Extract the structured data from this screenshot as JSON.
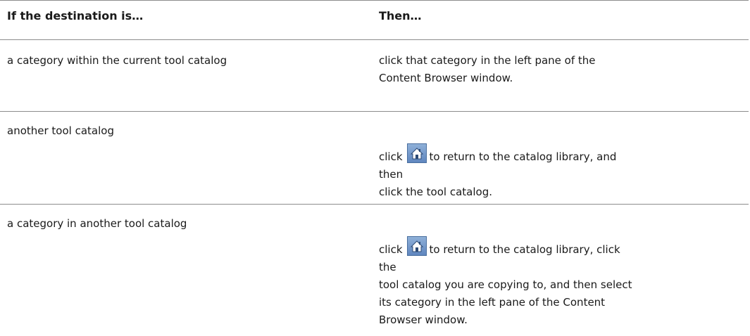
{
  "table": {
    "headers": {
      "col1": "If the destination is…",
      "col2": "Then…"
    },
    "rows": [
      {
        "destination": "a category within the current tool catalog",
        "action": "click that category in the left pane of the Content Browser window."
      },
      {
        "destination": "another tool catalog",
        "action_prefix": "click",
        "action_rest_1": "to return to the catalog library, and then",
        "action_rest_2": "click the tool catalog."
      },
      {
        "destination": "a category in another tool catalog",
        "action_prefix": "click",
        "action_rest_1": "to return to the catalog library, click the",
        "action_rest_2": "tool catalog you are copying to, and then select its category in the left pane of the Content Browser window."
      }
    ]
  },
  "icons": {
    "home": "home-icon"
  }
}
